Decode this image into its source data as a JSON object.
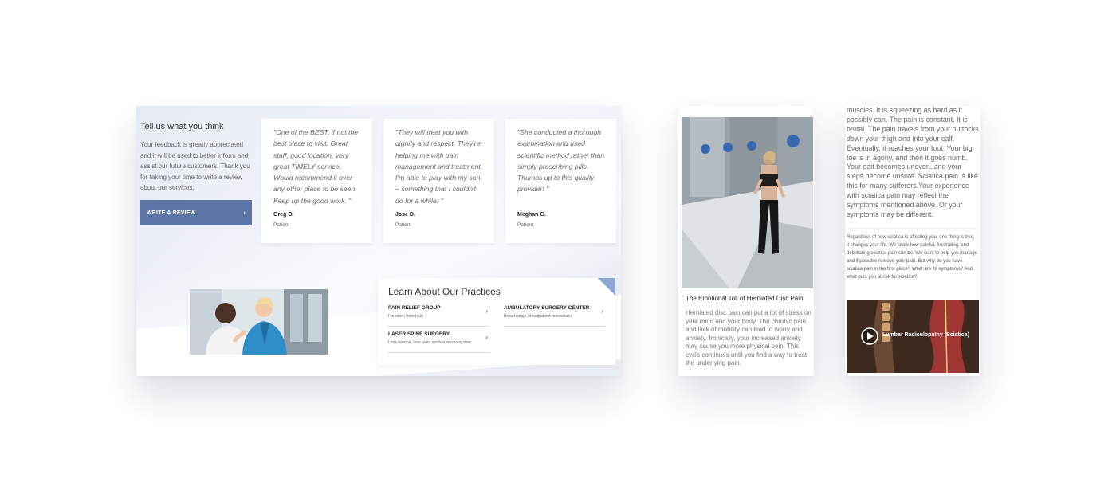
{
  "feedback": {
    "heading": "Tell us what you think",
    "text": "Your feedback is greatly appreciated and it will be used to better inform and assist our future customers. Thank you for taking your time to write a review about our services.",
    "button_label": "WRITE A REVIEW",
    "button_icon": "›"
  },
  "testimonials": [
    {
      "quote": "\"One of the BEST, if not the best place to visit. Great staff, good location, very great TIMELY service. Would recommend it over any other place to be seen. Keep up the good work. \"",
      "author": "Greg O.",
      "role": "Patient"
    },
    {
      "quote": "\"They will treat you with dignity and respect. They're helping me with pain management and treatment. I'm able to play with my son – something that I couldn't do for a while. \"",
      "author": "Jose D.",
      "role": "Patient"
    },
    {
      "quote": "\"She conducted a thorough examination and used scientific method rather than simply prescribing pills. Thumbs up to this quality provider! \"",
      "author": "Meghan G.",
      "role": "Patient"
    }
  ],
  "practices": {
    "title": "Learn About Our Practices",
    "chevron": "›",
    "items": [
      {
        "name": "PAIN RELIEF GROUP",
        "sub": "Freedom from pain"
      },
      {
        "name": "AMBULATORY SURGERY CENTER",
        "sub": "Broad range of outpatient procedures"
      },
      {
        "name": "LASER SPINE SURGERY",
        "sub": "Less trauma, less pain, quicker recovery time"
      }
    ]
  },
  "article": {
    "title": "The Emotional Toll of Herniated Disc Pain",
    "body": "Herniated disc pain can put a lot of stress on your mind and your body. The chronic pain and lack of mobility can lead to worry and anxiety. Ironically, your increased anxiety may cause you more physical pain. This cycle continues until you find a way to treat the underlying pain."
  },
  "sciatica": {
    "paragraph_large": "muscles. It is squeezing as hard as it possibly can. The pain is constant. It is brutal. The pain travels from your buttocks down your thigh and into your calf. Eventually, it reaches your foot. Your big toe is in agony, and then it goes numb. Your gait becomes uneven, and your steps become unsure. Sciatica pain is like this for many sufferers.Your experience with sciatica pain may reflect the symptoms mentioned above. Or your symptoms may be different.",
    "paragraph_small": "Regardless of how sciatica is affecting you, one thing is true, it changes your life. We know how painful, frustrating, and debilitating sciatica pain can be. We want to help you manage and if possible remove your pain. But why do you have sciatica pain in the first place? What are its symptoms? And what puts you at risk for sciatica?",
    "video_title": "Lumbar Radiculopathy (Sciatica)"
  },
  "colors": {
    "button_blue": "#5b76a6",
    "corner_accent": "#8fa6d2",
    "page_background": "#ffffff"
  },
  "icons": [
    "chevron-right-icon",
    "play-icon"
  ]
}
